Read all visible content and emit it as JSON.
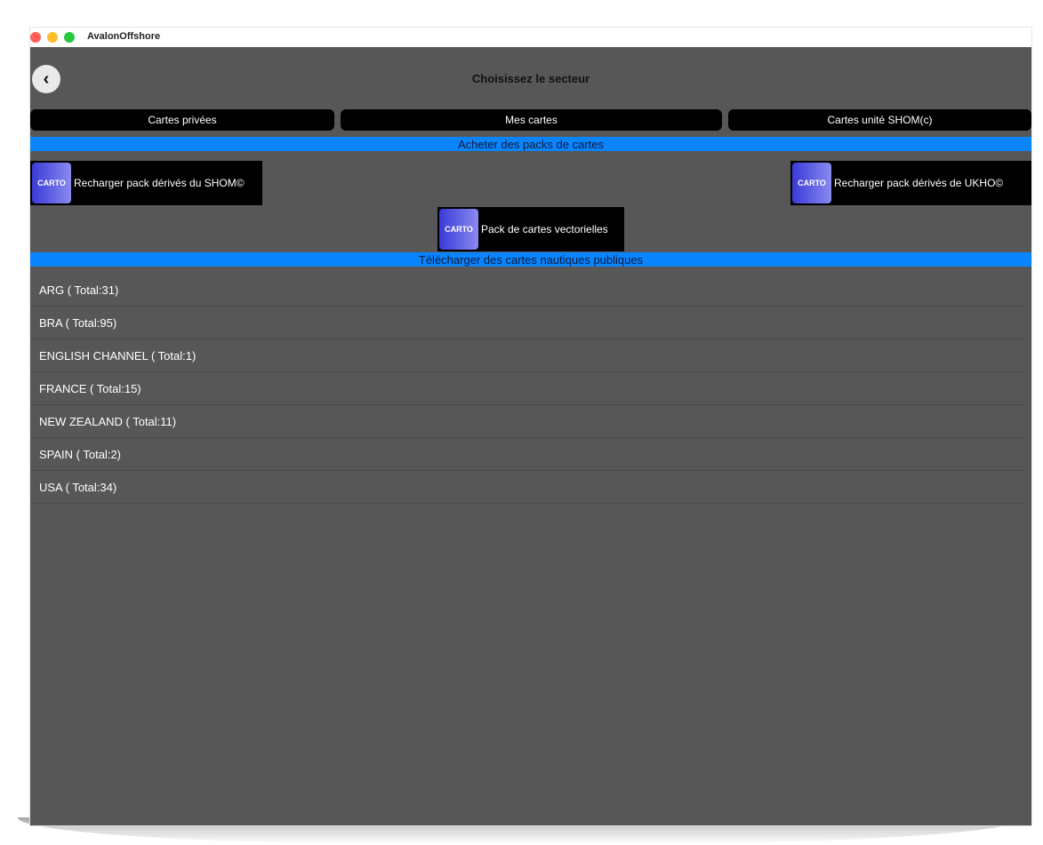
{
  "window": {
    "title": "AvalonOffshore"
  },
  "header": {
    "title": "Choisissez le secteur",
    "back_icon": "chevron-left-icon"
  },
  "tabs": [
    {
      "label": "Cartes privées"
    },
    {
      "label": "Mes cartes"
    },
    {
      "label": "Cartes unité SHOM(c)"
    }
  ],
  "sections": {
    "buy_packs": "Acheter des packs de cartes",
    "public_charts": "Télécharger des cartes nautiques publiques"
  },
  "packs": {
    "icon_text": "CARTO",
    "shom": "Recharger pack dérivés du SHOM©",
    "ukho": "Recharger pack dérivés de UKHO©",
    "vector": "Pack de cartes vectorielles"
  },
  "regions": [
    {
      "label": "ARG ( Total:31)"
    },
    {
      "label": "BRA ( Total:95)"
    },
    {
      "label": "ENGLISH CHANNEL ( Total:1)"
    },
    {
      "label": "FRANCE ( Total:15)"
    },
    {
      "label": "NEW ZEALAND ( Total:11)"
    },
    {
      "label": "SPAIN ( Total:2)"
    },
    {
      "label": "USA ( Total:34)"
    }
  ],
  "colors": {
    "background": "#575757",
    "section_bar": "#0a84ff",
    "button": "#000000"
  }
}
